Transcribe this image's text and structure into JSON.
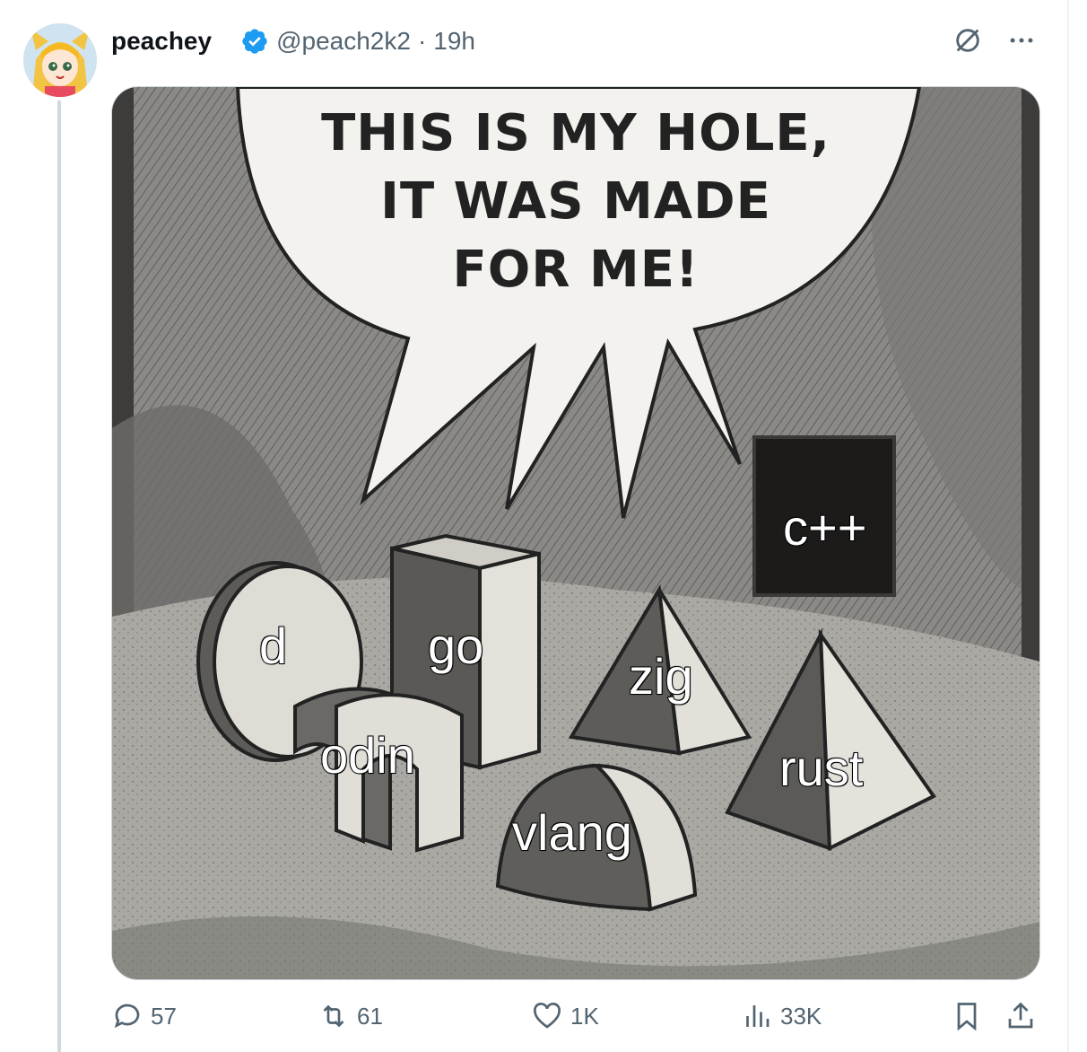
{
  "post": {
    "display_name": "peachey",
    "handle": "@peach2k2",
    "separator": "·",
    "time": "19h",
    "verified": true
  },
  "header_icons": [
    "grok-icon",
    "more-icon"
  ],
  "media": {
    "speech_bubble": [
      "THIS IS MY HOLE,",
      "IT WAS MADE",
      "FOR ME!"
    ],
    "labels": {
      "d": "d",
      "go": "go",
      "odin": "odin",
      "zig": "zig",
      "cpp": "c++",
      "vlang": "vlang",
      "rust": "rust"
    }
  },
  "actions": {
    "replies": "57",
    "reposts": "61",
    "likes": "1K",
    "views": "33K"
  },
  "colors": {
    "verified_badge": "#1d9bf0",
    "text_secondary": "#536471",
    "thread_line": "#cfd9de"
  }
}
